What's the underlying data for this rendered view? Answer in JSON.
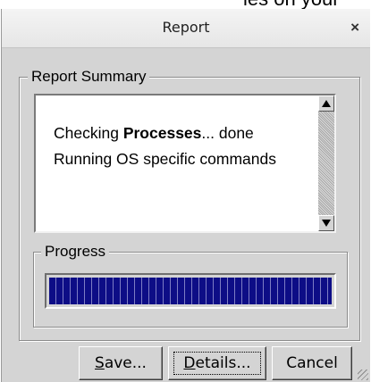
{
  "background_text": "ies on your system...",
  "window": {
    "title": "Report",
    "close_glyph": "×"
  },
  "summary": {
    "legend": "Report Summary",
    "lines": [
      {
        "prefix": "Checking ",
        "bold": "Processes",
        "suffix": "... done"
      },
      {
        "text": "Running OS specific commands"
      }
    ]
  },
  "progress": {
    "legend": "Progress",
    "value": 1.0
  },
  "buttons": {
    "save": {
      "mnemonic": "S",
      "rest": "ave..."
    },
    "details": {
      "mnemonic": "D",
      "rest": "etails..."
    },
    "cancel": {
      "label": "Cancel"
    }
  },
  "icons": {
    "close": "close-icon",
    "scroll_up": "arrow-up-icon",
    "scroll_down": "arrow-down-icon",
    "resize": "resize-grip-icon"
  },
  "colors": {
    "progress_fill": "#0d0d86",
    "dialog_bg": "#d4d4d4"
  }
}
